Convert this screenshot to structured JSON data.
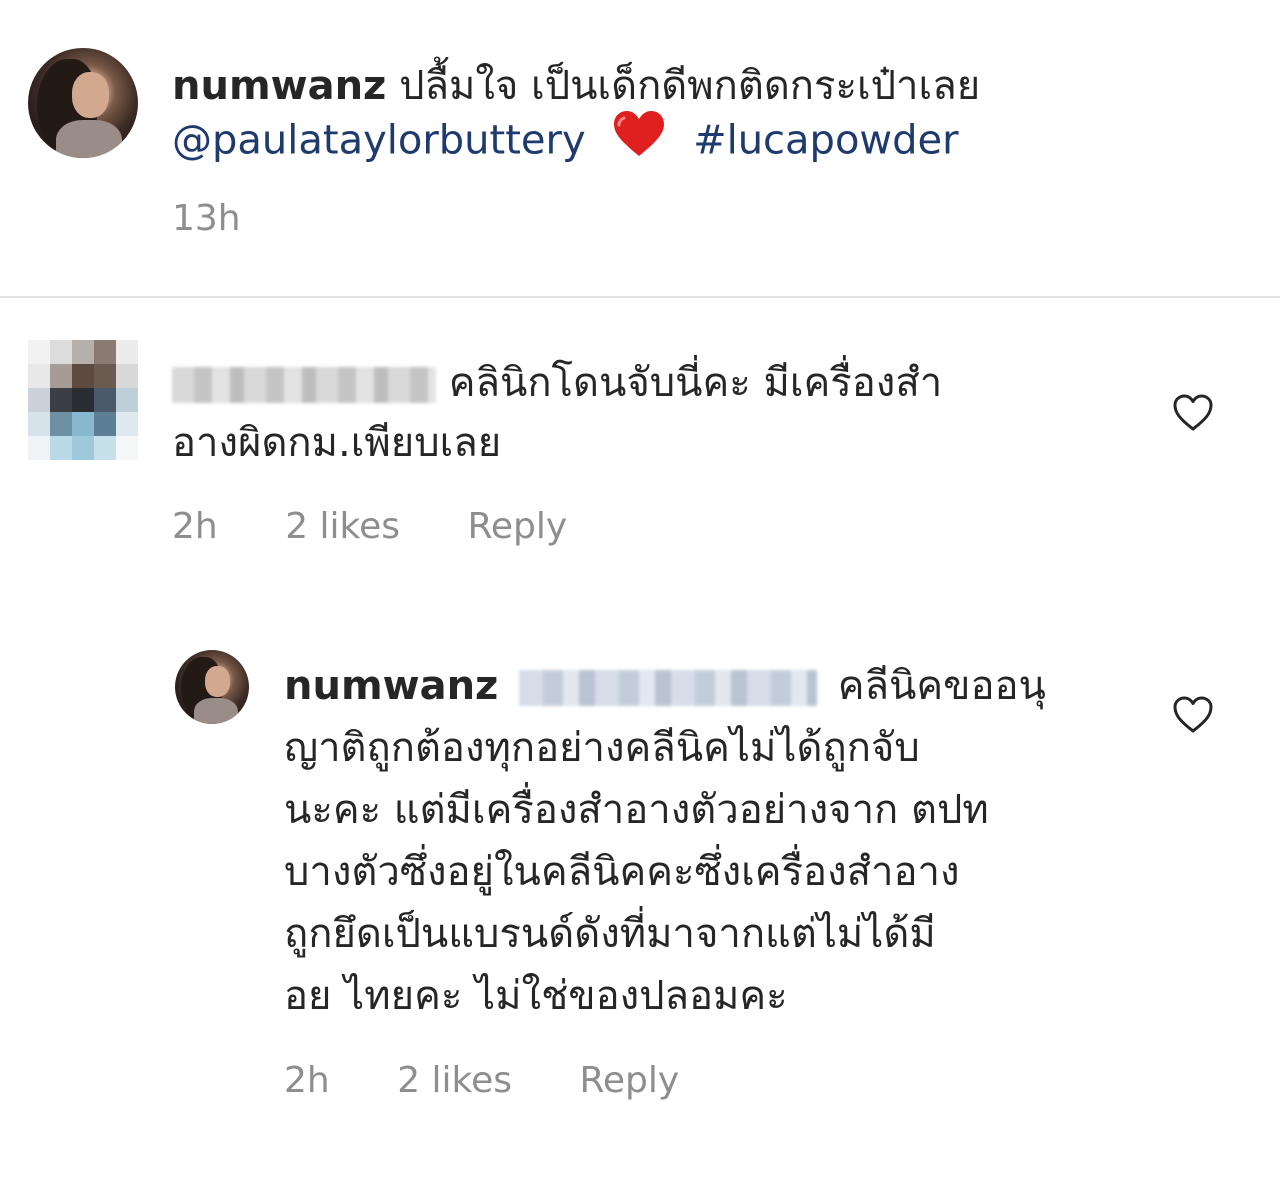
{
  "caption": {
    "username": "numwanz",
    "text": "ปลื้มใจ เป็นเด็กดีพกติดกระเป๋าเลย",
    "mention": "@paulataylorbuttery",
    "emoji": "❤️",
    "hashtag": "#lucapowder",
    "time": "13h"
  },
  "comments": [
    {
      "text_line1": "คลินิกโดนจับนี่คะ มีเครื่องสำ",
      "text_line2": "อางผิดกม.เพียบเลย",
      "time": "2h",
      "likes": "2 likes",
      "reply_label": "Reply"
    },
    {
      "username": "numwanz",
      "text_line1": "คลีนิคขออนุ",
      "text_line2": "ญาติถูกต้องทุกอย่างคลีนิคไม่ได้ถูกจับ",
      "text_line3": "นะคะ แต่มีเครื่องสำอางตัวอย่างจาก ตปท",
      "text_line4": "บางตัวซึ่งอยู่ในคลีนิคคะซึ่งเครื่องสำอาง",
      "text_line5": "ถูกยึดเป็นแบรนด์ดังที่มาจากแต่ไม่ได้มี",
      "text_line6": "อย ไทยคะ ไม่ใช่ของปลอมคะ",
      "time": "2h",
      "likes": "2 likes",
      "reply_label": "Reply"
    }
  ],
  "icons": {
    "like": "heart-outline-icon"
  },
  "colors": {
    "text": "#262626",
    "link": "#1f3b6e",
    "meta": "#8e8e8e",
    "heart": "#e0201f"
  }
}
